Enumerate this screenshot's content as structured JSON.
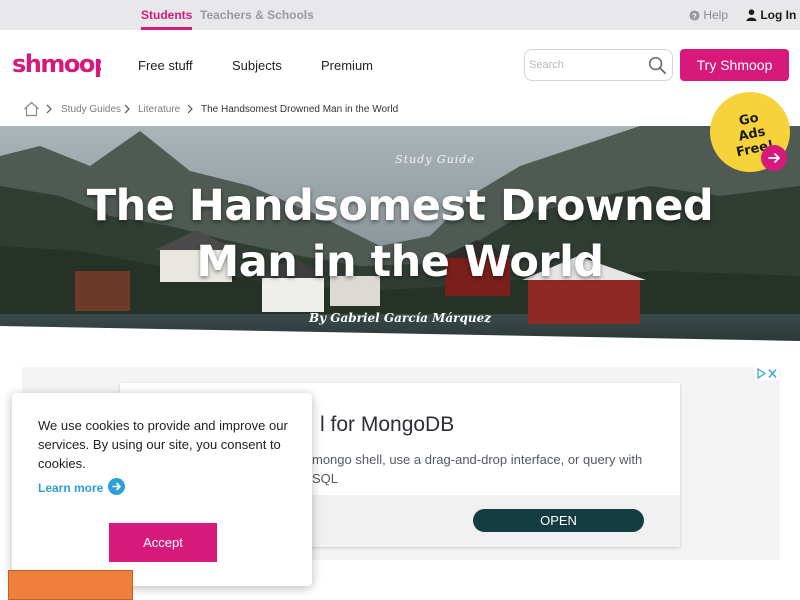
{
  "topbar": {
    "audience_tabs": [
      {
        "label": "Students"
      },
      {
        "label": "Teachers & Schools"
      }
    ],
    "help_label": "Help",
    "login_label": "Log In"
  },
  "header": {
    "logo_text": "shmoop",
    "nav": [
      {
        "label": "Free stuff"
      },
      {
        "label": "Subjects"
      },
      {
        "label": "Premium"
      }
    ],
    "search_placeholder": "Search",
    "cta_label": "Try Shmoop"
  },
  "breadcrumb": {
    "items": [
      "Study Guides",
      "Literature"
    ],
    "current": "The Handsomest Drowned Man in the World"
  },
  "hero": {
    "kicker": "Study Guide",
    "title": "The Handsomest Drowned Man in the World",
    "author": "By Gabriel García Márquez"
  },
  "ads_badge": {
    "line1": "Go",
    "line2": "Ads Free!"
  },
  "ad": {
    "headline": "l for MongoDB",
    "description": "mongo shell, use a drag-and-drop interface, or query with SQL",
    "button_label": "OPEN"
  },
  "cookie": {
    "text": "We use cookies to provide and improve our services. By using our site, you consent to cookies.",
    "learn_more": "Learn more",
    "accept_label": "Accept"
  },
  "colors": {
    "brand": "#d6197a",
    "badge": "#f6d23b",
    "link": "#2e9fd8",
    "ad_button": "#143d43"
  }
}
